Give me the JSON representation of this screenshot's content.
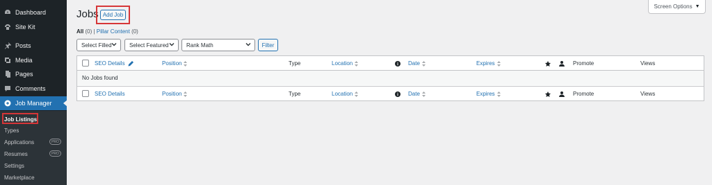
{
  "sidebar": {
    "items": [
      {
        "label": "Dashboard",
        "icon": "dashboard-icon"
      },
      {
        "label": "Site Kit",
        "icon": "sitekit-icon"
      },
      {
        "label": "Posts",
        "icon": "pin-icon"
      },
      {
        "label": "Media",
        "icon": "media-icon"
      },
      {
        "label": "Pages",
        "icon": "pages-icon"
      },
      {
        "label": "Comments",
        "icon": "comments-icon"
      },
      {
        "label": "Job Manager",
        "icon": "job-manager-icon"
      }
    ],
    "submenu": [
      {
        "label": "Job Listings"
      },
      {
        "label": "Types"
      },
      {
        "label": "Applications",
        "badge": "PRO"
      },
      {
        "label": "Resumes",
        "badge": "PRO"
      },
      {
        "label": "Settings"
      },
      {
        "label": "Marketplace"
      }
    ]
  },
  "header": {
    "title": "Jobs",
    "add_label": "Add Job",
    "screen_options": "Screen Options"
  },
  "views": {
    "all_label": "All",
    "all_count": "(0)",
    "separator": "|",
    "pillar_label": "Pillar Content",
    "pillar_count": "(0)"
  },
  "filters": {
    "filled": "Select Filled",
    "featured": "Select Featured",
    "rank_math": "Rank Math",
    "filter_button": "Filter"
  },
  "table": {
    "columns": {
      "seo": "SEO Details",
      "position": "Position",
      "type": "Type",
      "location": "Location",
      "date": "Date",
      "expires": "Expires",
      "promote": "Promote",
      "views": "Views"
    },
    "empty_message": "No Jobs found"
  },
  "colors": {
    "accent": "#2271b1",
    "sidebar_bg": "#1d2327",
    "highlight": "#d63638"
  }
}
